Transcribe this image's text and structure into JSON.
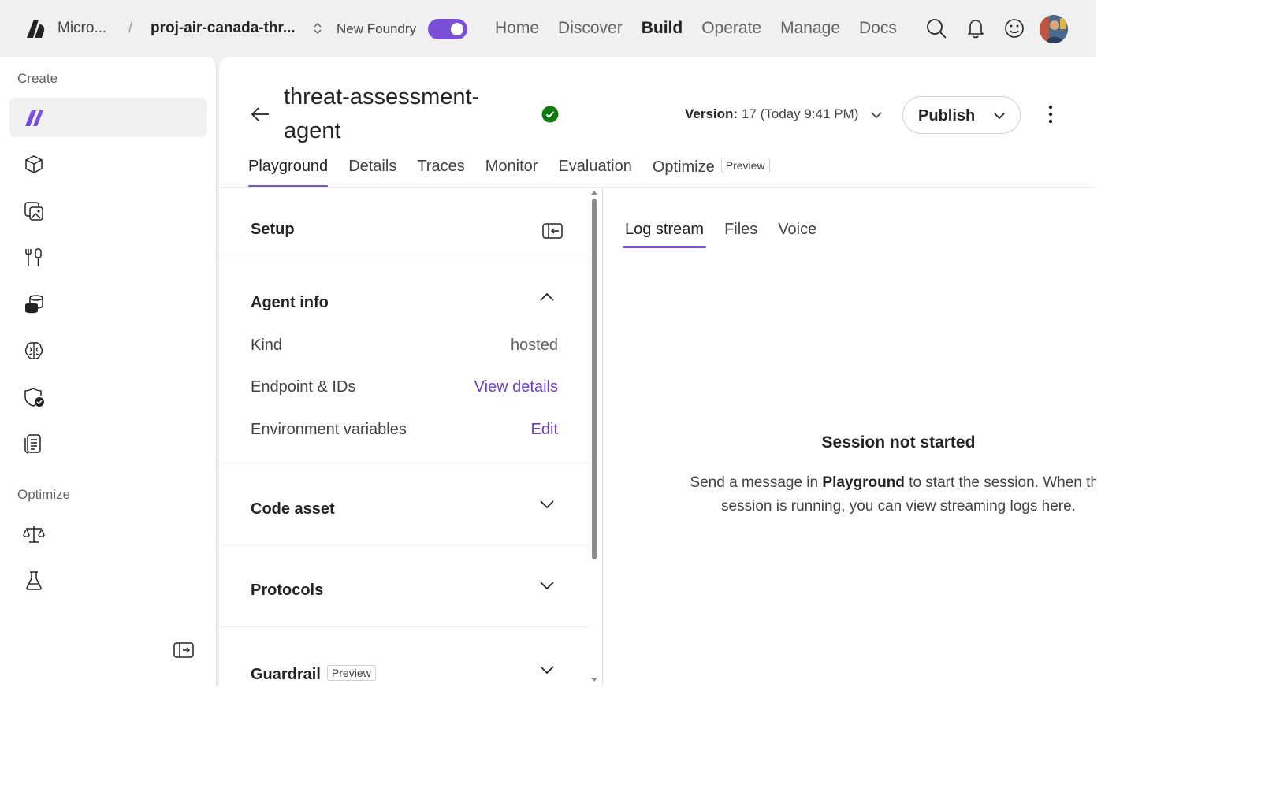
{
  "topbar": {
    "org_name": "Micro...",
    "separator": "/",
    "project_name": "proj-air-canada-thr...",
    "new_foundry_label": "New Foundry",
    "new_foundry_enabled": true,
    "nav": [
      "Home",
      "Discover",
      "Build",
      "Operate",
      "Manage",
      "Docs"
    ],
    "active_nav": "Build",
    "icons": [
      "search-icon",
      "bell-icon",
      "feedback-smiley-icon",
      "avatar"
    ]
  },
  "rail": {
    "create_label": "Create",
    "optimize_label": "Optimize",
    "create_icons": [
      "agents-icon",
      "models-icon",
      "images-icon",
      "tools-icon",
      "data-icon",
      "brain-icon",
      "shield-check-icon",
      "document-icon"
    ],
    "optimize_icons": [
      "scales-icon",
      "flask-icon"
    ],
    "collapse_icon": "expand-panel-icon"
  },
  "header": {
    "agent_name": "threat-assessment-agent",
    "status": "success",
    "version_label": "Version:",
    "version_value": "17 (Today 9:41 PM)",
    "publish_label": "Publish"
  },
  "tabs": {
    "items": [
      "Playground",
      "Details",
      "Traces",
      "Monitor",
      "Evaluation",
      "Optimize"
    ],
    "active": "Playground",
    "optimize_badge": "Preview"
  },
  "setup": {
    "title": "Setup",
    "agent_info": {
      "title": "Agent info",
      "kind_label": "Kind",
      "kind_value": "hosted",
      "endpoint_label": "Endpoint & IDs",
      "endpoint_link": "View details",
      "env_label": "Environment variables",
      "env_link": "Edit"
    },
    "code_asset_title": "Code asset",
    "protocols_title": "Protocols",
    "guardrail_title": "Guardrail",
    "guardrail_badge": "Preview"
  },
  "right": {
    "tabs": [
      "Log stream",
      "Files",
      "Voice"
    ],
    "active_tab": "Log stream",
    "empty_title": "Session not started",
    "empty_text_before": "Send a message in ",
    "empty_text_bold": "Playground",
    "empty_text_after": " to start the session. When the",
    "empty_text_line2": "session is running, you can view streaming logs here."
  },
  "colors": {
    "accent": "#7b4fd6",
    "link": "#6b3fc6",
    "success": "#107c10",
    "chrome_bg": "#f0f0f0"
  }
}
